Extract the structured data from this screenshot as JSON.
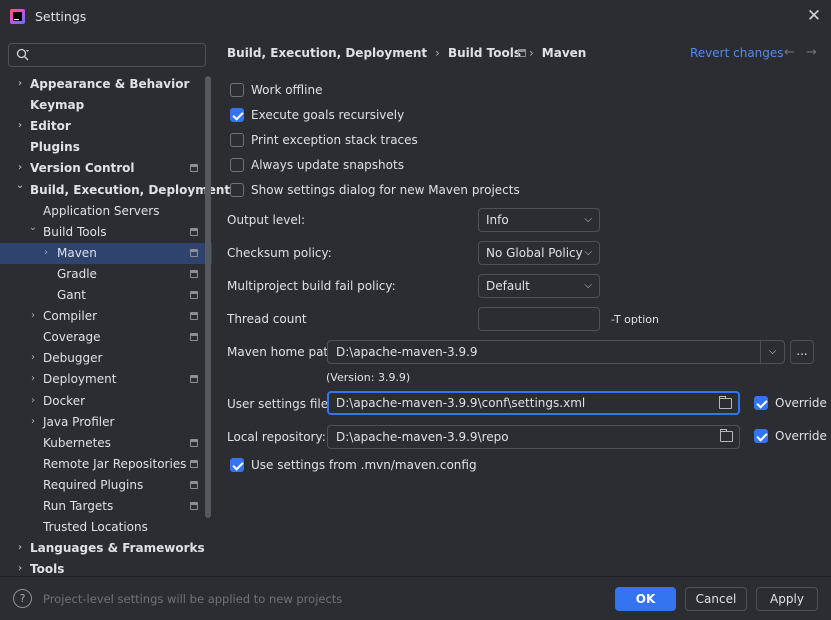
{
  "window": {
    "title": "Settings",
    "close_icon": "close-icon"
  },
  "search": {
    "placeholder": "",
    "icon": "search-icon"
  },
  "sidebar": {
    "items": [
      {
        "label": "Appearance & Behavior",
        "bold": true,
        "expandable": true,
        "expanded": false,
        "level": 0
      },
      {
        "label": "Keymap",
        "bold": true,
        "expandable": false,
        "level": 0
      },
      {
        "label": "Editor",
        "bold": true,
        "expandable": true,
        "expanded": false,
        "level": 0
      },
      {
        "label": "Plugins",
        "bold": true,
        "expandable": false,
        "level": 0
      },
      {
        "label": "Version Control",
        "bold": true,
        "expandable": true,
        "expanded": false,
        "level": 0,
        "project_icon": true
      },
      {
        "label": "Build, Execution, Deployment",
        "bold": true,
        "expandable": true,
        "expanded": true,
        "level": 0
      },
      {
        "label": "Application Servers",
        "level": 1
      },
      {
        "label": "Build Tools",
        "expandable": true,
        "expanded": true,
        "level": 1,
        "project_icon": true
      },
      {
        "label": "Maven",
        "expandable": true,
        "expanded": false,
        "level": 2,
        "project_icon": true,
        "selected": true
      },
      {
        "label": "Gradle",
        "level": 2,
        "project_icon": true
      },
      {
        "label": "Gant",
        "level": 2,
        "project_icon": true
      },
      {
        "label": "Compiler",
        "expandable": true,
        "expanded": false,
        "level": 1,
        "project_icon": true
      },
      {
        "label": "Coverage",
        "level": 1,
        "project_icon": true
      },
      {
        "label": "Debugger",
        "expandable": true,
        "expanded": false,
        "level": 1
      },
      {
        "label": "Deployment",
        "expandable": true,
        "expanded": false,
        "level": 1,
        "project_icon": true
      },
      {
        "label": "Docker",
        "expandable": true,
        "expanded": false,
        "level": 1
      },
      {
        "label": "Java Profiler",
        "expandable": true,
        "expanded": false,
        "level": 1
      },
      {
        "label": "Kubernetes",
        "level": 1,
        "project_icon": true
      },
      {
        "label": "Remote Jar Repositories",
        "level": 1,
        "project_icon": true
      },
      {
        "label": "Required Plugins",
        "level": 1,
        "project_icon": true
      },
      {
        "label": "Run Targets",
        "level": 1,
        "project_icon": true
      },
      {
        "label": "Trusted Locations",
        "level": 1
      },
      {
        "label": "Languages & Frameworks",
        "bold": true,
        "expandable": true,
        "expanded": false,
        "level": 0
      },
      {
        "label": "Tools",
        "bold": true,
        "expandable": true,
        "expanded": false,
        "level": 0
      }
    ]
  },
  "breadcrumb": {
    "parts": [
      "Build, Execution, Deployment",
      "Build Tools",
      "Maven"
    ],
    "separator": "›"
  },
  "header": {
    "revert_label": "Revert changes",
    "back_arrow": "←",
    "forward_arrow": "→"
  },
  "checkboxes": [
    {
      "label": "Work offline",
      "checked": false
    },
    {
      "label": "Execute goals recursively",
      "checked": true
    },
    {
      "label": "Print exception stack traces",
      "checked": false
    },
    {
      "label": "Always update snapshots",
      "checked": false
    },
    {
      "label": "Show settings dialog for new Maven projects",
      "checked": false
    }
  ],
  "fields": {
    "output_level": {
      "label": "Output level:",
      "value": "Info"
    },
    "checksum_policy": {
      "label": "Checksum policy:",
      "value": "No Global Policy"
    },
    "fail_policy": {
      "label": "Multiproject build fail policy:",
      "value": "Default"
    },
    "thread_count": {
      "label": "Thread count",
      "value": "",
      "suffix": "-T option"
    },
    "maven_home": {
      "label": "Maven home path:",
      "value": "D:\\apache-maven-3.9.9",
      "browse_label": "...",
      "version": "(Version: 3.9.9)"
    },
    "user_settings": {
      "label": "User settings file:",
      "value": "D:\\apache-maven-3.9.9\\conf\\settings.xml",
      "override_label": "Override",
      "override_checked": true
    },
    "local_repo": {
      "label": "Local repository:",
      "value": "D:\\apache-maven-3.9.9\\repo",
      "override_label": "Override",
      "override_checked": true
    },
    "use_mvn_config": {
      "label": "Use settings from .mvn/maven.config",
      "checked": true
    }
  },
  "footer": {
    "help_label": "?",
    "note": "Project-level settings will be applied to new projects",
    "ok_label": "OK",
    "cancel_label": "Cancel",
    "apply_label": "Apply"
  },
  "colors": {
    "background": "#2b2d30",
    "accent": "#3574f0",
    "selection": "#2e436e",
    "link": "#548af7",
    "text": "#dfe1e5",
    "muted_text": "#6f737a"
  }
}
